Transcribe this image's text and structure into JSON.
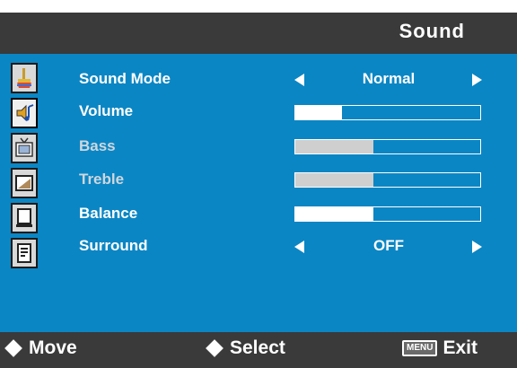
{
  "title": "Sound",
  "sidebar": [
    {
      "icon": "picture-paint-icon",
      "selected": false
    },
    {
      "icon": "sound-speaker-icon",
      "selected": true
    },
    {
      "icon": "tv-channel-icon",
      "selected": false
    },
    {
      "icon": "screen-icon",
      "selected": false
    },
    {
      "icon": "monitor-icon",
      "selected": false
    },
    {
      "icon": "setup-document-icon",
      "selected": false
    }
  ],
  "rows": [
    {
      "label": "Sound Mode",
      "type": "choice",
      "value": "Normal",
      "enabled": true
    },
    {
      "label": "Volume",
      "type": "slider",
      "level": 0.25,
      "enabled": true
    },
    {
      "label": "Bass",
      "type": "slider",
      "level": 0.42,
      "enabled": false
    },
    {
      "label": "Treble",
      "type": "slider",
      "level": 0.42,
      "enabled": false
    },
    {
      "label": "Balance",
      "type": "slider",
      "level": 0.42,
      "enabled": true
    },
    {
      "label": "Surround",
      "type": "choice",
      "value": "OFF",
      "enabled": true
    }
  ],
  "footer": {
    "move": "Move",
    "select": "Select",
    "menu_key": "MENU",
    "exit": "Exit"
  },
  "colors": {
    "header": "#3a3a3a",
    "content": "#0b86c4",
    "enabled_text": "#ffffff",
    "disabled_text": "#cfd7dd",
    "fill_enabled": "#ffffff",
    "fill_disabled": "#cfcfcf"
  }
}
